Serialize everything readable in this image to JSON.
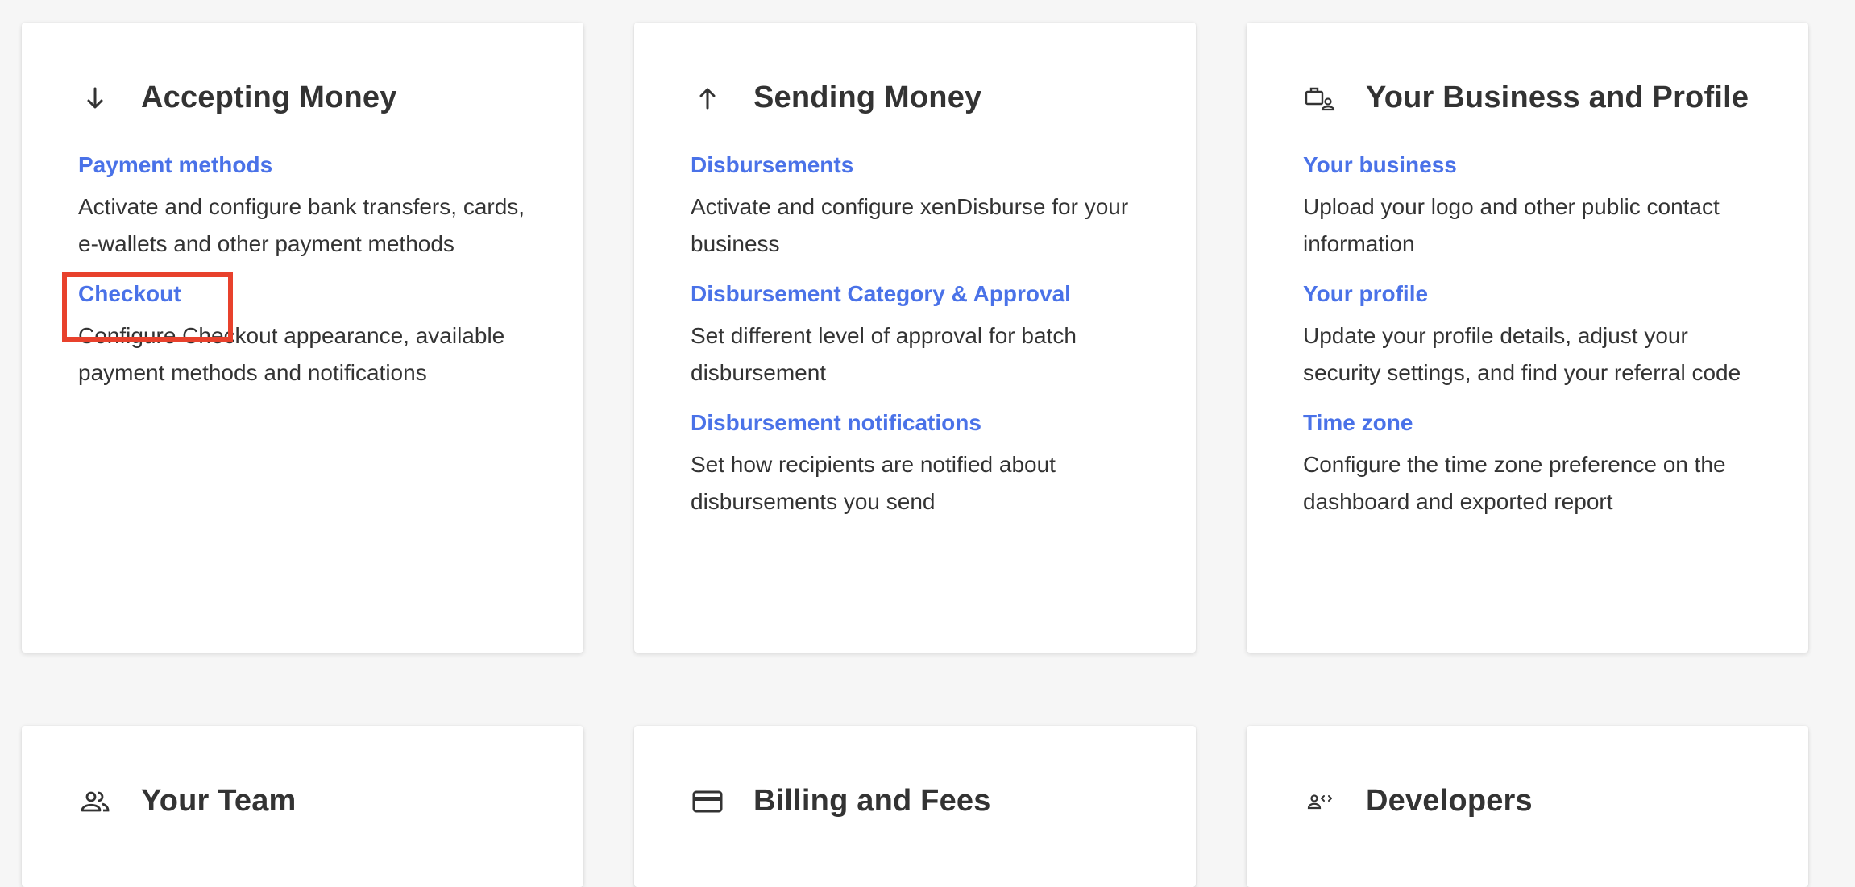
{
  "colors": {
    "page_bg": "#f6f6f6",
    "card_bg": "#ffffff",
    "link": "#4a72e8",
    "text": "#333333",
    "highlight": "#e8412c"
  },
  "cards": [
    {
      "title": "Accepting Money",
      "icon": "arrow-down-icon",
      "items": [
        {
          "link": "Payment methods",
          "desc": "Activate and configure bank transfers, cards, e-wallets and other payment methods"
        },
        {
          "link": "Checkout",
          "desc": "Configure Checkout appearance, available payment methods and notifications"
        }
      ]
    },
    {
      "title": "Sending Money",
      "icon": "arrow-up-icon",
      "items": [
        {
          "link": "Disbursements",
          "desc": "Activate and configure xenDisburse for your business"
        },
        {
          "link": "Disbursement Category & Approval",
          "desc": "Set different level of approval for batch disbursement"
        },
        {
          "link": "Disbursement notifications",
          "desc": "Set how recipients are notified about disbursements you send"
        }
      ]
    },
    {
      "title": "Your Business and Profile",
      "icon": "business-profile-icon",
      "items": [
        {
          "link": "Your business",
          "desc": "Upload your logo and other public contact information"
        },
        {
          "link": "Your profile",
          "desc": "Update your profile details, adjust your security settings, and find your referral code"
        },
        {
          "link": "Time zone",
          "desc": "Configure the time zone preference on the dashboard and exported report"
        }
      ]
    },
    {
      "title": "Your Team",
      "icon": "team-icon"
    },
    {
      "title": "Billing and Fees",
      "icon": "credit-card-icon"
    },
    {
      "title": "Developers",
      "icon": "developer-icon"
    }
  ]
}
